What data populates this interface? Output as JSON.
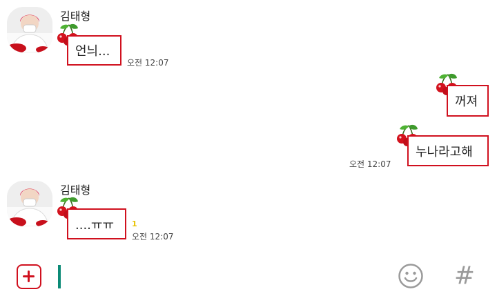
{
  "messages": {
    "m1": {
      "sender": "김태형",
      "text": "언늬...",
      "time": "오전 12:07"
    },
    "m2": {
      "text": "꺼져"
    },
    "m3": {
      "text": "누나라고해",
      "time": "오전 12:07"
    },
    "m4": {
      "sender": "김태형",
      "text": "....ㅠㅠ",
      "time": "오전 12:07",
      "unread": "1"
    }
  },
  "composer": {
    "plus_icon": "plus-icon",
    "emoji_icon": "smiley-icon",
    "hash_icon": "hash-icon",
    "hash_glyph": "#"
  },
  "colors": {
    "bubble_border": "#d0101e",
    "cursor": "#0b8a76",
    "unread": "#e8c200"
  }
}
